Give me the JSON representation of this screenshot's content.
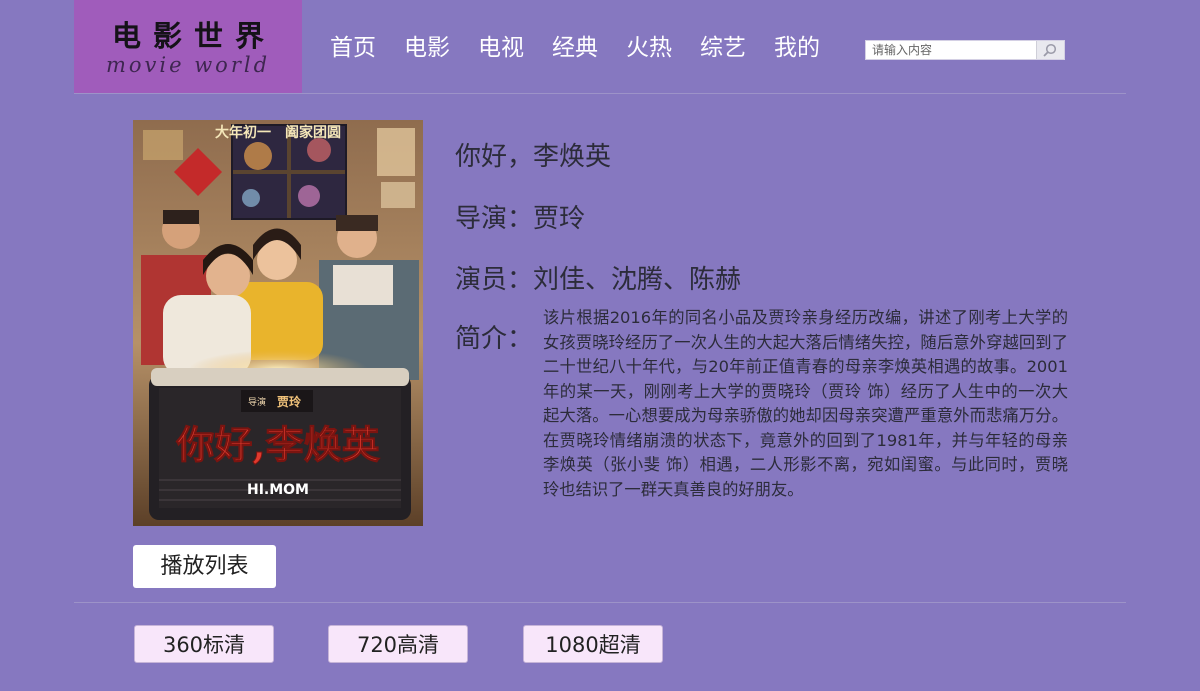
{
  "logo": {
    "chinese": "电影世界",
    "english": "movie world"
  },
  "nav": {
    "items": [
      "首页",
      "电影",
      "电视",
      "经典",
      "火热",
      "综艺",
      "我的"
    ]
  },
  "search": {
    "placeholder": "请输入内容",
    "value": "",
    "icon": "search-icon"
  },
  "movie": {
    "title": "你好，李焕英",
    "director_label": "导演：",
    "director": "贾玲",
    "actors_label": "演员：",
    "actors": "刘佳、沈腾、陈赫",
    "intro_label": "简介：",
    "intro": "该片根据2016年的同名小品及贾玲亲身经历改编，讲述了刚考上大学的女孩贾晓玲经历了一次人生的大起大落后情绪失控，随后意外穿越回到了二十世纪八十年代，与20年前正值青春的母亲李焕英相遇的故事。2001年的某一天，刚刚考上大学的贾晓玲（贾玲 饰）经历了人生中的一次大起大落。一心想要成为母亲骄傲的她却因母亲突遭严重意外而悲痛万分。在贾晓玲情绪崩溃的状态下，竟意外的回到了1981年，并与年轻的母亲李焕英（张小斐 饰）相遇，二人形影不离，宛如闺蜜。与此同时，贾晓玲也结识了一群天真善良的好朋友。"
  },
  "poster": {
    "top_banner": "大年初一　阖家团圆",
    "director_tag": "导演",
    "director_name": "贾玲",
    "title": "你好,李焕英",
    "subtitle": "HI.MOM"
  },
  "playlist_label": "播放列表",
  "qualities": [
    "360标清",
    "720高清",
    "1080超清"
  ],
  "colors": {
    "background": "#8678c0",
    "logo_bg": "#a05cbb",
    "quality_button": "#f8e6fa"
  }
}
